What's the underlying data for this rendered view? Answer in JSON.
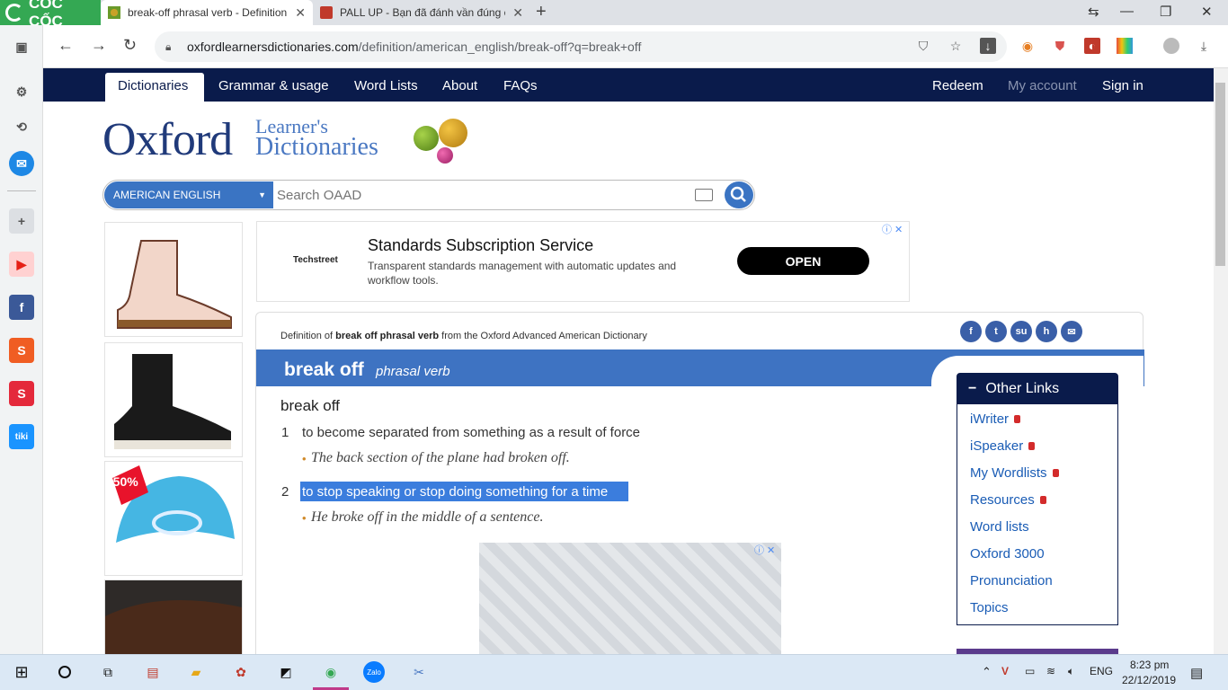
{
  "browser": {
    "brand": "CỐC CỐC",
    "tabs": [
      {
        "title": "break-off phrasal verb - Definition"
      },
      {
        "title": "PALL UP - Bạn đã đánh vần đúng c"
      }
    ],
    "new_tab": "+",
    "url_domain": "oxfordlearnersdictionaries.com",
    "url_path": "/definition/american_english/break-off?q=break+off"
  },
  "site_nav": {
    "left": [
      "Dictionaries",
      "Grammar & usage",
      "Word Lists",
      "About",
      "FAQs"
    ],
    "right": [
      "Redeem",
      "My account",
      "Sign in"
    ]
  },
  "logo": {
    "oxford": "Oxford",
    "learners": "Learner's",
    "dictionaries": "Dictionaries"
  },
  "search": {
    "language": "AMERICAN ENGLISH",
    "placeholder": "Search OAAD"
  },
  "ad": {
    "brand": "Techstreet",
    "title": "Standards Subscription Service",
    "description": "Transparent standards management with automatic updates and workflow tools.",
    "button": "OPEN",
    "discount": "-50%"
  },
  "entry": {
    "definition_of_prefix": "Definition of",
    "definition_of_term": "break off phrasal verb",
    "definition_of_suffix": "from the Oxford Advanced American Dictionary",
    "headword": "break off",
    "pos": "phrasal verb",
    "subhead": "break off",
    "senses": [
      {
        "num": "1",
        "def": "to become separated from something as a result of force",
        "example": "The back section of the plane had broken off."
      },
      {
        "num": "2",
        "def": "to stop speaking or stop doing something for a time",
        "example": "He broke off in the middle of a sentence."
      }
    ]
  },
  "other_links": {
    "title": "Other Links",
    "items": [
      {
        "label": "iWriter",
        "locked": true
      },
      {
        "label": "iSpeaker",
        "locked": true
      },
      {
        "label": "My Wordlists",
        "locked": true
      },
      {
        "label": "Resources",
        "locked": true
      },
      {
        "label": "Word lists",
        "locked": false
      },
      {
        "label": "Oxford 3000",
        "locked": false
      },
      {
        "label": "Pronunciation",
        "locked": false
      },
      {
        "label": "Topics",
        "locked": false
      }
    ]
  },
  "taskbar": {
    "language": "ENG",
    "time": "8:23 pm",
    "date": "22/12/2019"
  },
  "colors": {
    "nav_bg": "#0a1b4b",
    "accent": "#3e73c2",
    "highlight": "#3b7ddd"
  }
}
